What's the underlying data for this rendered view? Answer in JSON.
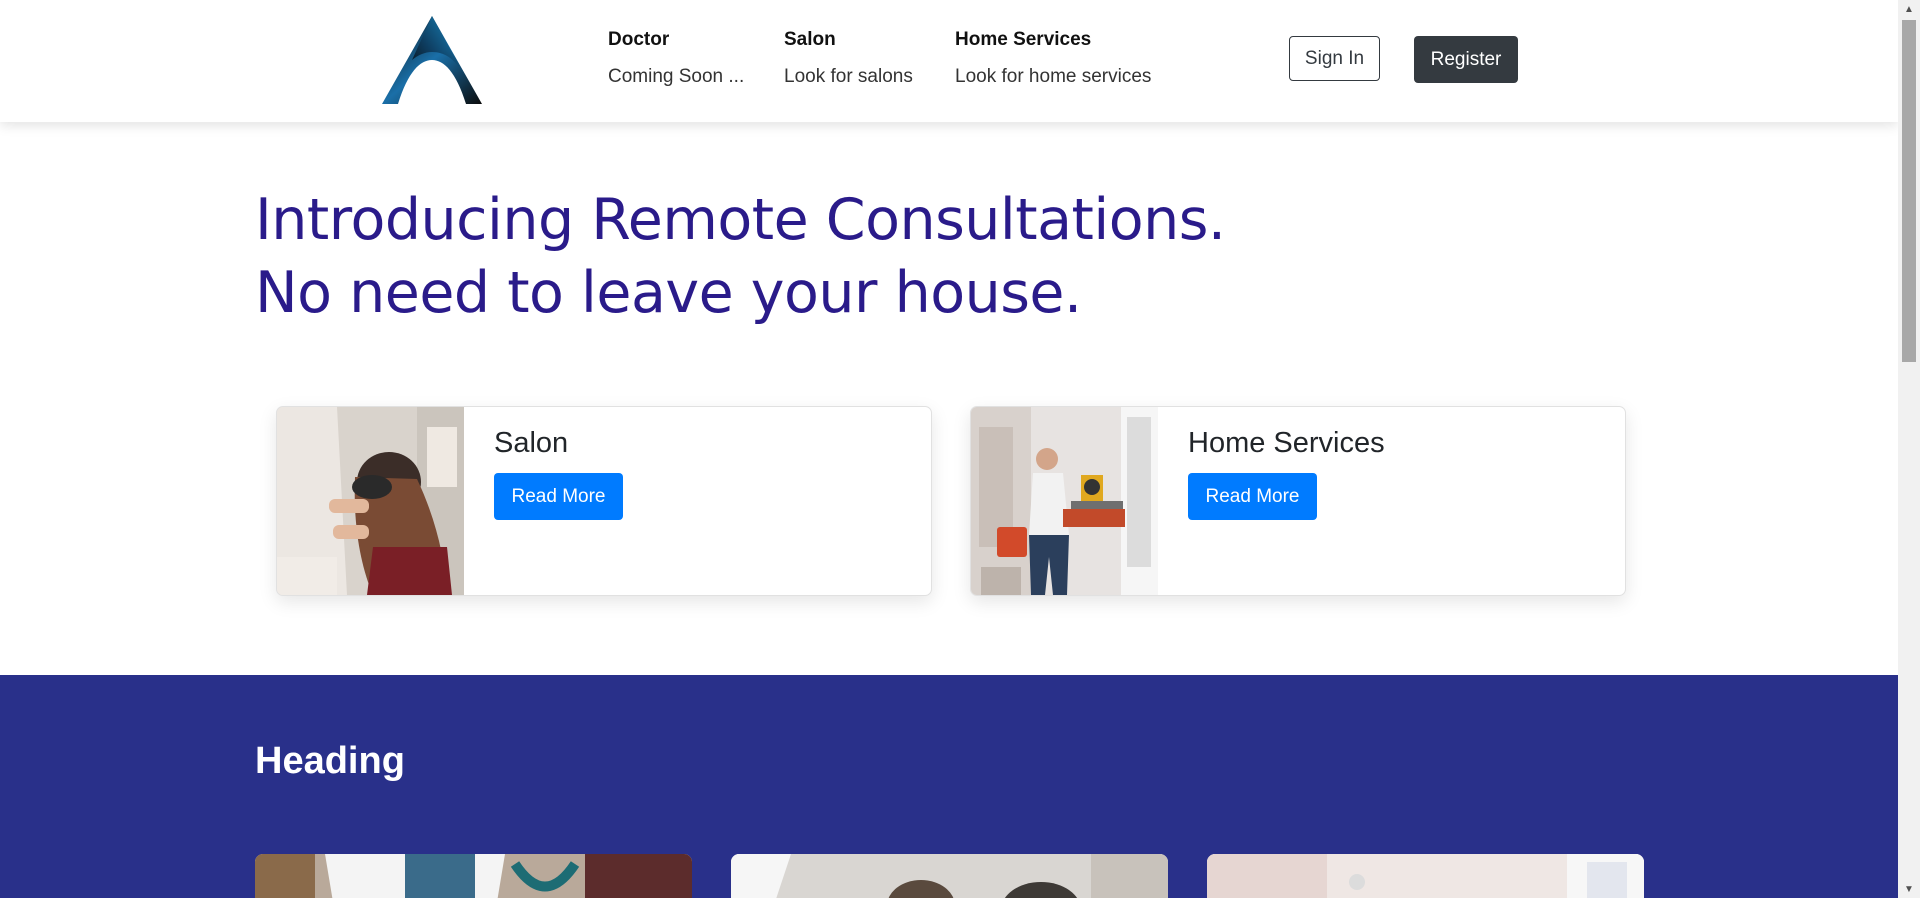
{
  "header": {
    "nav": [
      {
        "title": "Doctor",
        "subtitle": "Coming Soon ..."
      },
      {
        "title": "Salon",
        "subtitle": "Look for salons"
      },
      {
        "title": "Home Services",
        "subtitle": "Look for home services"
      }
    ],
    "sign_in_label": "Sign In",
    "register_label": "Register"
  },
  "hero": {
    "line1": "Introducing Remote Consultations.",
    "line2": "No need to leave your house."
  },
  "services": [
    {
      "title": "Salon",
      "button_label": "Read More"
    },
    {
      "title": "Home Services",
      "button_label": "Read More"
    }
  ],
  "section": {
    "heading": "Heading"
  },
  "colors": {
    "hero_text": "#2a1b8a",
    "band_background": "#29308a",
    "primary_button": "#007bff",
    "dark_button": "#343a40"
  },
  "icons": {
    "scroll_up": "triangle-up",
    "scroll_down": "triangle-down"
  }
}
